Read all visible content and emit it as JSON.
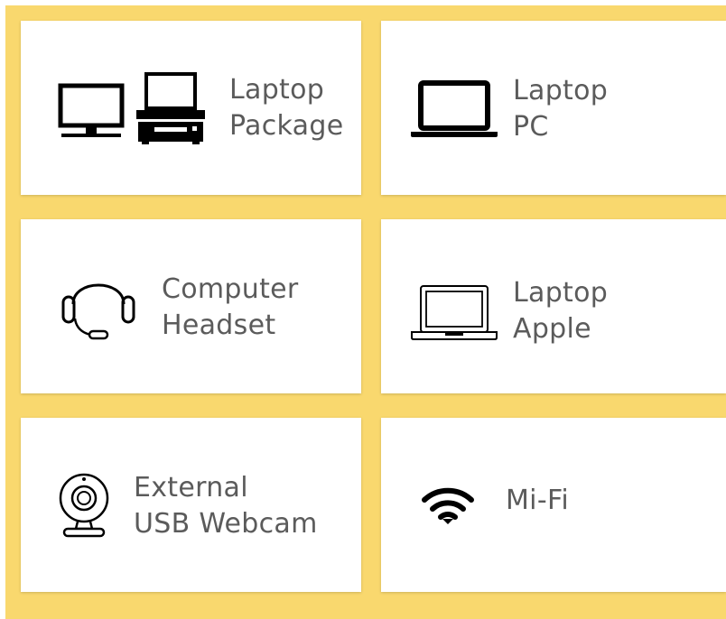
{
  "colors": {
    "background": "#f9d86e",
    "card": "#ffffff",
    "text": "#5b5b5b",
    "icon": "#000000"
  },
  "items": [
    {
      "line1": "Laptop",
      "line2": "Package",
      "icon": "laptop-package-icon"
    },
    {
      "line1": "Laptop",
      "line2": "PC",
      "icon": "laptop-pc-icon"
    },
    {
      "line1": "Computer",
      "line2": "Headset",
      "icon": "headset-icon"
    },
    {
      "line1": "Laptop",
      "line2": "Apple",
      "icon": "laptop-apple-icon"
    },
    {
      "line1": "External",
      "line2": "USB Webcam",
      "icon": "webcam-icon"
    },
    {
      "line1": "Mi-Fi",
      "icon": "wifi-icon"
    }
  ]
}
